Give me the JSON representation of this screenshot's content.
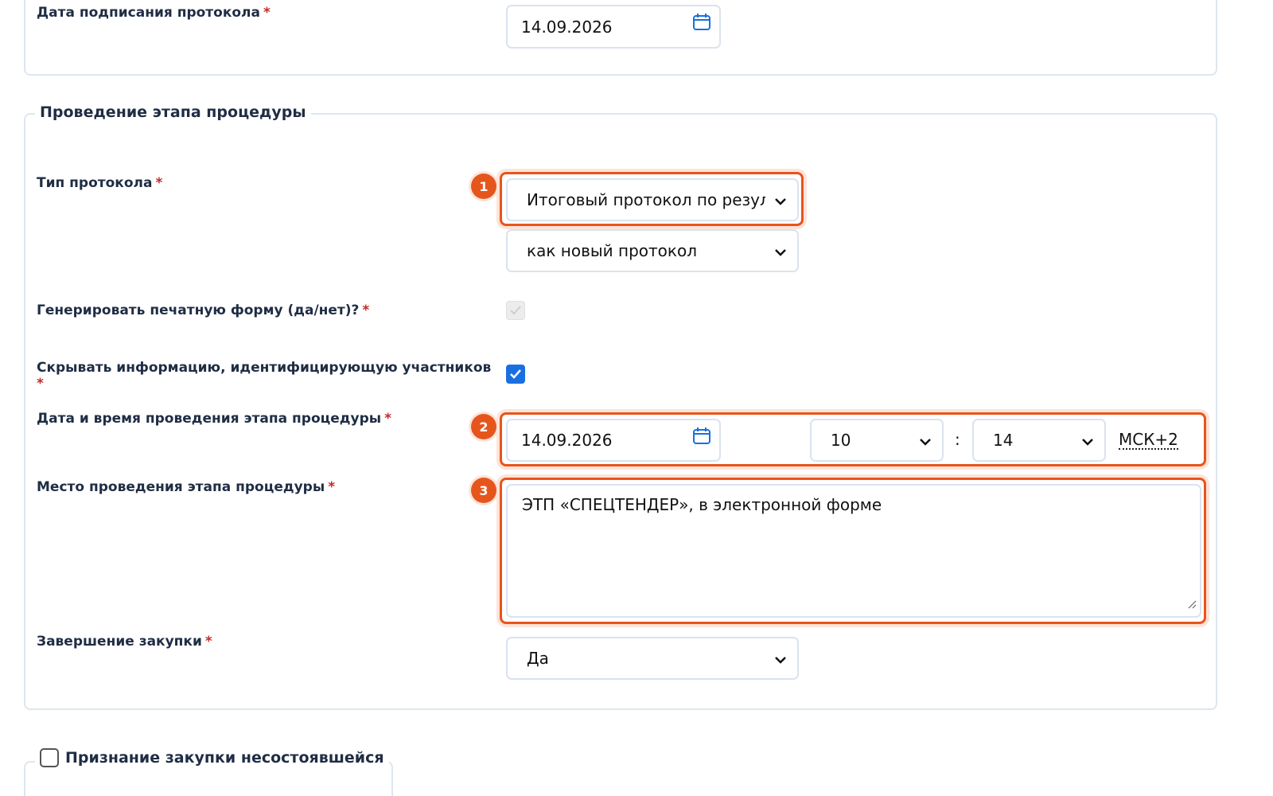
{
  "top_section": {
    "signing_date_label": "Дата подписания протокола",
    "signing_date_value": "14.09.2026"
  },
  "stage_section": {
    "legend": "Проведение этапа процедуры",
    "protocol_type_label": "Тип протокола",
    "protocol_type_value": "Итоговый протокол по результ",
    "protocol_mode_value": "как новый протокол",
    "print_form_label": "Генерировать печатную форму (да/нет)?",
    "print_form_checked": true,
    "print_form_disabled": true,
    "hide_info_label": "Скрывать информацию, идентифицирующую участников",
    "hide_info_checked": true,
    "datetime_label": "Дата и время проведения этапа процедуры",
    "datetime_date_value": "14.09.2026",
    "datetime_hour_value": "10",
    "datetime_separator": ":",
    "datetime_minute_value": "14",
    "timezone": "МСК+2",
    "place_label": "Место проведения этапа процедуры",
    "place_value": "ЭТП «СПЕЦТЕНДЕР», в электронной форме",
    "completion_label": "Завершение закупки",
    "completion_value": "Да"
  },
  "failed_section": {
    "legend": "Признание закупки несостоявшейся",
    "checked": false
  },
  "markers": [
    "1",
    "2",
    "3"
  ],
  "required_mark": "*",
  "colors": {
    "highlight": "#e8541c",
    "required": "#c62828",
    "checkbox_checked": "#1a6fe0",
    "text": "#1f2d44",
    "border": "#dbe3ee"
  },
  "icons": [
    "calendar-icon",
    "chevron-down-icon",
    "check-icon",
    "resize-handle-icon"
  ]
}
